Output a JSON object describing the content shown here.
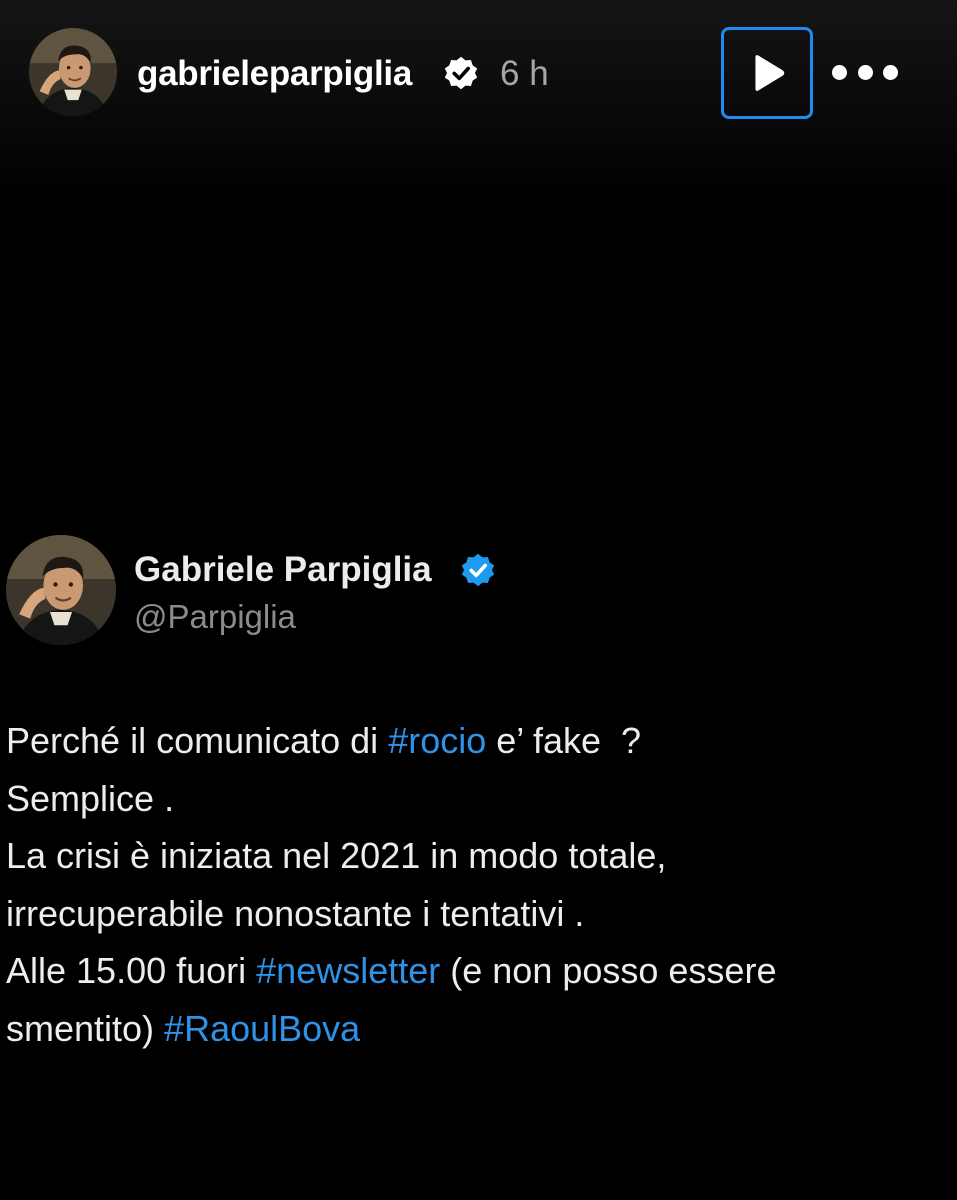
{
  "story": {
    "username": "gabrieleparpiglia",
    "time": "6 h",
    "verified_icon": "verified-badge-icon",
    "play_icon": "play-icon",
    "more_icon": "more-options-icon",
    "accent_color": "#1d8cf0"
  },
  "tweet": {
    "name": "Gabriele Parpiglia",
    "handle": "@Parpiglia",
    "verified_color": "#1d9bf0",
    "hashtag_color": "#2f92e6",
    "lines": [
      {
        "t1": "Perché il comunicato di ",
        "tag1": "#rocio",
        "t2": " e’ fake  ?"
      },
      {
        "text": "Semplice ."
      },
      {
        "text": "La crisi è iniziata nel 2021 in modo totale,"
      },
      {
        "text": "irrecuperabile nonostante i tentativi ."
      },
      {
        "t1": "Alle 15.00 fuori ",
        "tag1": "#newsletter",
        "t2": " (e non posso essere"
      },
      {
        "t1": "smentito) ",
        "tag1": "#RaoulBova"
      }
    ]
  }
}
